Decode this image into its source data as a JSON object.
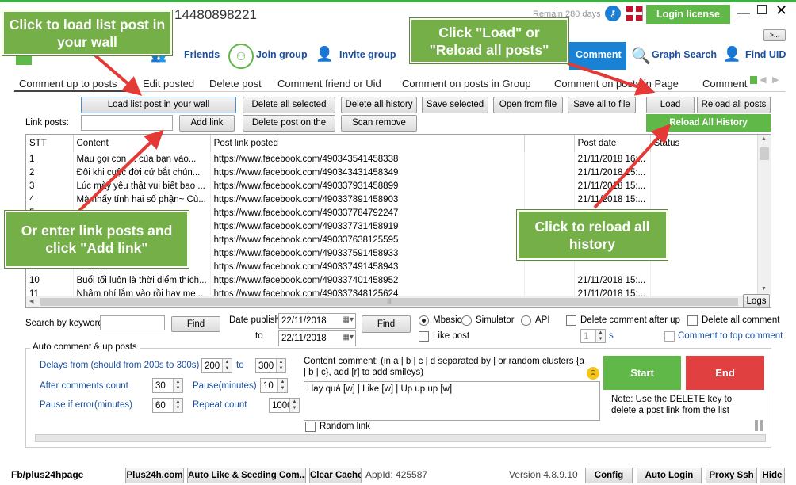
{
  "titlebar": {
    "phone": "14480898221",
    "remain": "Remain 280 days",
    "login": "Login license"
  },
  "nav": {
    "friends": "Friends",
    "join_group": "Join group",
    "invite_group": "Invite group",
    "comment": "Comment",
    "graph_search": "Graph Search",
    "find_uid": "Find UID",
    "more": ">..."
  },
  "tabs": [
    "Comment up to posts",
    "Edit posted",
    "Delete post",
    "Comment friend or Uid",
    "Comment on posts in Group",
    "Comment on posts in Page",
    "Comment"
  ],
  "toolbar": {
    "load_wall": "Load list post in your wall",
    "delete_all_selected": "Delete all selected",
    "delete_all_history": "Delete all history",
    "save_selected": "Save selected",
    "open_from_file": "Open from file",
    "save_all_to_file": "Save all to file",
    "load": "Load",
    "reload_all_posts": "Reload all posts",
    "link_posts_label": "Link posts:",
    "add_link": "Add link",
    "delete_post_on": "Delete post on the",
    "scan_remove": "Scan remove",
    "reload_all_history": "Reload All History"
  },
  "table": {
    "headers": [
      "STT",
      "Content",
      "Post link posted",
      "",
      "Post date",
      "Status"
    ],
    "rows": [
      [
        "1",
        "Mau gọi con ... của bạn vào...",
        "https://www.facebook.com/490343541458338",
        "21/11/2018 16:..."
      ],
      [
        "2",
        "Đôi khi cuộc đời cứ bắt chún...",
        "https://www.facebook.com/490343431458349",
        "21/11/2018 15:..."
      ],
      [
        "3",
        "Lúc mày yêu thật vui biết bao ...",
        "https://www.facebook.com/490337931458899",
        "21/11/2018 15:..."
      ],
      [
        "4",
        "Mà nhấy tính hai số phận~ Cù...",
        "https://www.facebook.com/490337891458903",
        "21/11/2018 15:..."
      ],
      [
        "5",
        "",
        "https://www.facebook.com/490337784792247",
        ""
      ],
      [
        "6",
        "",
        "https://www.facebook.com/490337731458919",
        ""
      ],
      [
        "7",
        "",
        "https://www.facebook.com/490337638125595",
        ""
      ],
      [
        "8",
        "",
        "https://www.facebook.com/490337591458933",
        ""
      ],
      [
        "9",
        "Đơn ... ",
        "https://www.facebook.com/490337491458943",
        ""
      ],
      [
        "10",
        "Buổi tối luôn là thời điểm thích...",
        "https://www.facebook.com/490337401458952",
        "21/11/2018 15:..."
      ],
      [
        "11",
        "Nhâm phí lắm vào rồi hay me...",
        "https://www.facebook.com/490337348125624",
        "21/11/2018 15:..."
      ]
    ],
    "logs": "Logs"
  },
  "filters": {
    "search_label": "Search by keyword",
    "find": "Find",
    "date_publish": "Date publish:",
    "to": "to",
    "date_from": "22/11/2018",
    "date_to": "22/11/2018",
    "find2": "Find",
    "mbasic": "Mbasic",
    "simulator": "Simulator",
    "api": "API",
    "like_post": "Like post",
    "delete_after": "Delete comment after up",
    "delete_all_comment": "Delete all comment",
    "delete_after_value": "1",
    "s": "s",
    "comment_top": "Comment to top comment"
  },
  "auto": {
    "legend": "Auto comment & up posts",
    "delays_label": "Delays from (should from 200s to 300s)",
    "delay_from": "200",
    "to": "to",
    "delay_to": "300",
    "after_label": "After comments count",
    "after_value": "30",
    "pause_label": "Pause(minutes)",
    "pause_value": "10",
    "pause_error_label": "Pause if error(minutes)",
    "pause_error_value": "60",
    "repeat_label": "Repeat count",
    "repeat_value": "1000",
    "content_label": "Content comment: (in a | b | c | d separated by | or random clusters {a | b | c}, add [r] to add smileys)",
    "content_value": "Hay quá [w] | Like [w] | Up up up [w]",
    "random_link": "Random link",
    "start": "Start",
    "end": "End",
    "note": "Note: Use the DELETE key to delete a post link from the list"
  },
  "statusbar": {
    "fb": "Fb/plus24hpage",
    "plus24h": "Plus24h.com",
    "auto_like": "Auto Like & Seeding Com...",
    "clear_cache": "Clear Cache",
    "appid": "AppId: 425587",
    "version": "Version 4.8.9.10",
    "config": "Config",
    "auto_login": "Auto Login",
    "proxy": "Proxy Ssh",
    "hide": "Hide"
  },
  "callouts": {
    "load_wall": "Click to load list post in your wall",
    "load_reload": "Click \"Load\" or \"Reload all posts\"",
    "add_link": "Or enter link posts and click \"Add link\"",
    "reload_history": "Click to reload all history"
  },
  "colors": {
    "green": "#5fb847",
    "red": "#e04040",
    "navy": "#1a50a0",
    "callout": "#74b047"
  }
}
